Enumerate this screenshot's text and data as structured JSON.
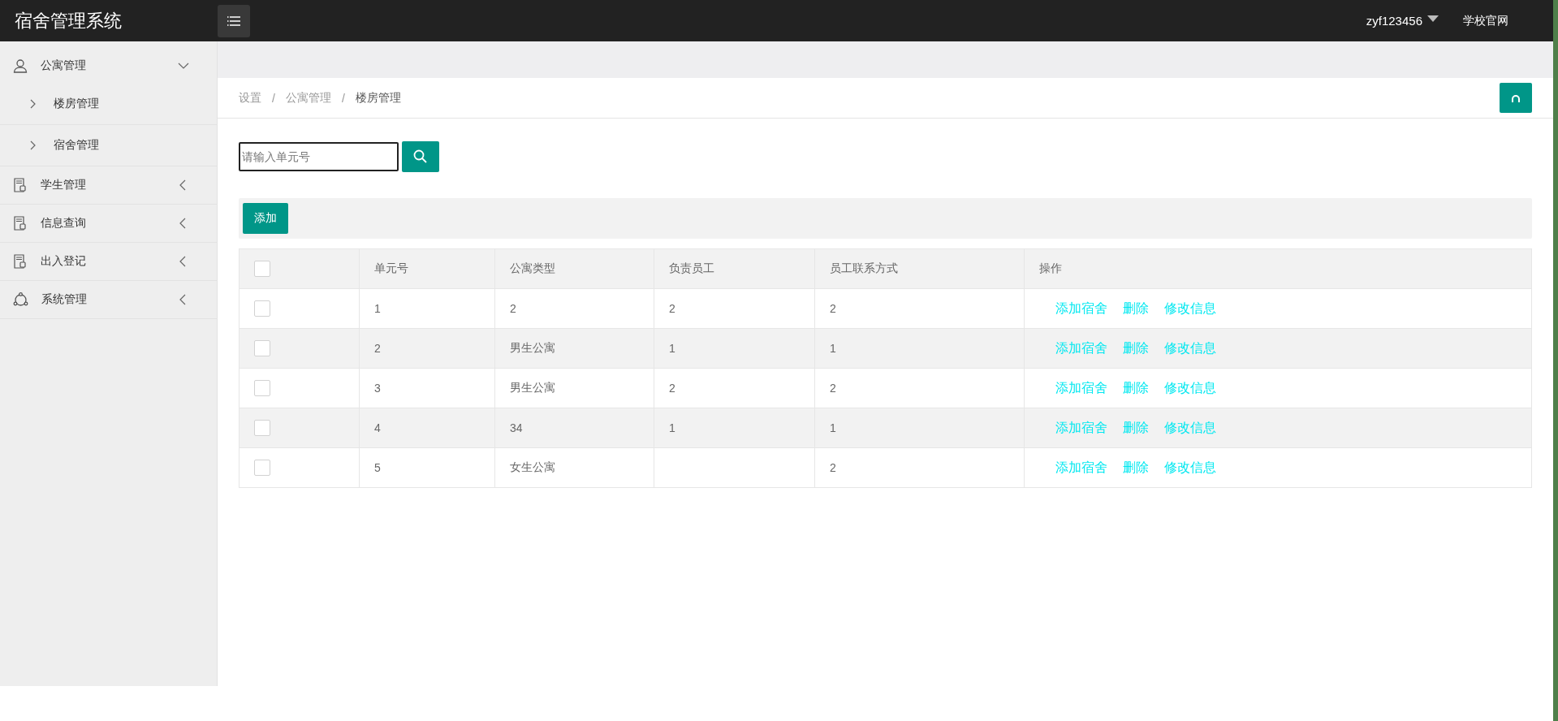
{
  "header": {
    "title": "宿舍管理系统",
    "user": "zyf123456",
    "link": "学校官网"
  },
  "sidebar": {
    "items": [
      {
        "label": "公寓管理",
        "expanded": true,
        "children": [
          {
            "label": "楼房管理"
          },
          {
            "label": "宿舍管理"
          }
        ]
      },
      {
        "label": "学生管理",
        "expanded": false
      },
      {
        "label": "信息查询",
        "expanded": false
      },
      {
        "label": "出入登记",
        "expanded": false
      },
      {
        "label": "系统管理",
        "expanded": false
      }
    ]
  },
  "breadcrumb": {
    "items": [
      "设置",
      "公寓管理",
      "楼房管理"
    ],
    "separator": "/"
  },
  "search": {
    "placeholder": "请输入单元号"
  },
  "toolbar": {
    "add_button": "添加"
  },
  "table": {
    "columns": [
      "单元号",
      "公寓类型",
      "负责员工",
      "员工联系方式",
      "操作"
    ],
    "header_checked": false,
    "rows": [
      {
        "checked": false,
        "cells": [
          "1",
          "2",
          "2",
          "2"
        ],
        "actions": [
          "添加宿舍",
          "删除",
          "修改信息"
        ]
      },
      {
        "checked": false,
        "cells": [
          "2",
          "男生公寓",
          "1",
          "1"
        ],
        "actions": [
          "添加宿舍",
          "删除",
          "修改信息"
        ]
      },
      {
        "checked": false,
        "cells": [
          "3",
          "男生公寓",
          "2",
          "2"
        ],
        "actions": [
          "添加宿舍",
          "删除",
          "修改信息"
        ]
      },
      {
        "checked": false,
        "cells": [
          "4",
          "34",
          "1",
          "1"
        ],
        "actions": [
          "添加宿舍",
          "删除",
          "修改信息"
        ]
      },
      {
        "checked": false,
        "cells": [
          "5",
          "女生公寓",
          "",
          "2"
        ],
        "actions": [
          "添加宿舍",
          "删除",
          "修改信息"
        ]
      }
    ]
  }
}
